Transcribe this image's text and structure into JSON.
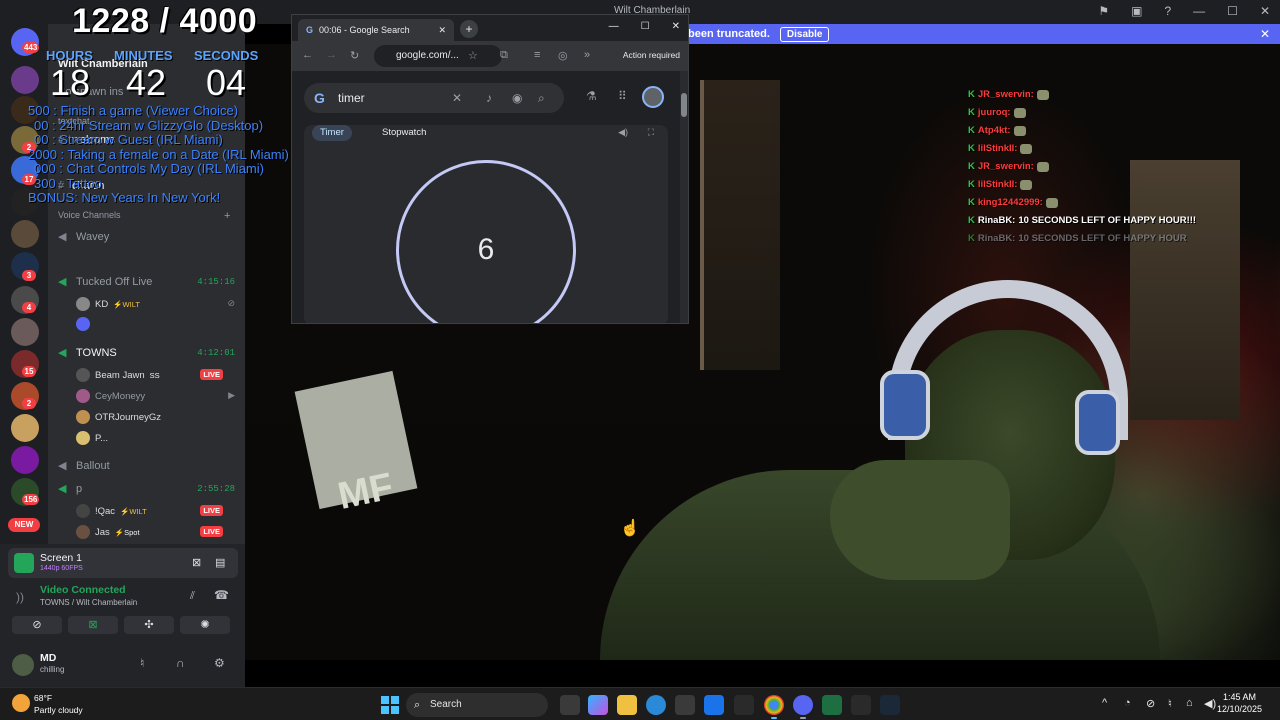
{
  "discord": {
    "window_title": "Wilt Chamberlain",
    "banner": {
      "text": "been truncated.",
      "button": "Disable",
      "close": "✕"
    },
    "server_badges": [
      "443",
      "2",
      "17",
      "3",
      "4",
      "15",
      "2",
      "156"
    ],
    "new_badge": "NEW",
    "channels": {
      "server_name": "Wilt Chamberlain",
      "text_channels": [
        "welcome",
        "chattin"
      ],
      "text_header_partial": "textchat",
      "spawn_partial": "Bo spawn ins",
      "voice_header": "Voice Channels",
      "voice": [
        {
          "name": "Wavey",
          "timer": ""
        },
        {
          "name": "Tucked Off Live",
          "timer": "4:15:16"
        },
        {
          "name": "TOWNS",
          "timer": "4:12:01"
        },
        {
          "name": "Ballout",
          "timer": ""
        },
        {
          "name": "p",
          "timer": "2:55:28"
        }
      ],
      "tucked_users": [
        {
          "name": "KD",
          "tag": "⚡WILT"
        }
      ],
      "towns_users": [
        {
          "name": "Beam Jawn",
          "tag": "SS",
          "live": "LIVE"
        },
        {
          "name": "CeyMoneyy",
          "tag": "",
          "live": ""
        },
        {
          "name": "OTRJourneyGz",
          "tag": "",
          "live": ""
        },
        {
          "name": "P...",
          "tag": "",
          "live": ""
        }
      ],
      "p_users": [
        {
          "name": "!Qac",
          "tag": "⚡WILT",
          "live": "LIVE"
        },
        {
          "name": "Jas",
          "tag": "⚡Spot",
          "live": "LIVE"
        }
      ]
    },
    "panel": {
      "screen_title": "Screen 1",
      "screen_sub": "1440p 60FPS",
      "vc_connected": "Video Connected",
      "vc_location": "TOWNS / Wilt Chamberlain",
      "username": "MD",
      "status": "chilling"
    }
  },
  "overlay": {
    "counter": "1228 / 4000",
    "labels": {
      "hours": "HOURS",
      "minutes": "MINUTES",
      "seconds": "SECONDS"
    },
    "time": {
      "hours": "18",
      "minutes": "42",
      "seconds": "04"
    },
    "goals": [
      "500 : Finish a game (Viewer Choice)",
      "00 : 24hr Stream w GlizzyGlo (Desktop)",
      "00 : Stream w Guest (IRL Miami)",
      "2000 : Taking a female on a Date (IRL Miami)",
      "000 : Chat Controls My Day (IRL Miami)",
      "300 : Tattoo",
      "BONUS: New Years In New York!"
    ]
  },
  "chrome": {
    "tab_title": "00:06 - Google Search",
    "url": "google.com/...",
    "action": "Action required",
    "search_query": "timer",
    "chips": [
      "Timer",
      "Stopwatch"
    ],
    "timer_value": "6"
  },
  "chat": [
    {
      "user": "JR_swervin:",
      "msg": "",
      "color": "#ff3b3b"
    },
    {
      "user": "juuroq:",
      "msg": "",
      "color": "#ff3b3b"
    },
    {
      "user": "Atp4kt:",
      "msg": "",
      "color": "#ff3b3b"
    },
    {
      "user": "lilStinkII:",
      "msg": "",
      "color": "#ff3b3b"
    },
    {
      "user": "JR_swervin:",
      "msg": "",
      "color": "#ff3b3b"
    },
    {
      "user": "lilStinkII:",
      "msg": "",
      "color": "#ff3b3b"
    },
    {
      "user": "king12442999:",
      "msg": "",
      "color": "#ff3b3b"
    },
    {
      "user": "RinaBK:",
      "msg": "10 SECONDS LEFT OF HAPPY HOUR!!!",
      "color": "#ffffff"
    },
    {
      "user": "RinaBK:",
      "msg": "10 SECONDS LEFT OF HAPPY HOUR",
      "color": "#9aa0a6"
    }
  ],
  "taskbar": {
    "weather_temp": "68°F",
    "weather_desc": "Partly cloudy",
    "search": "Search",
    "time": "1:45 AM",
    "date": "12/10/2025",
    "colors": {
      "accent": "#4cc2ff",
      "discord": "#5865f2",
      "live": "#f23f43",
      "online": "#23a55a"
    }
  }
}
